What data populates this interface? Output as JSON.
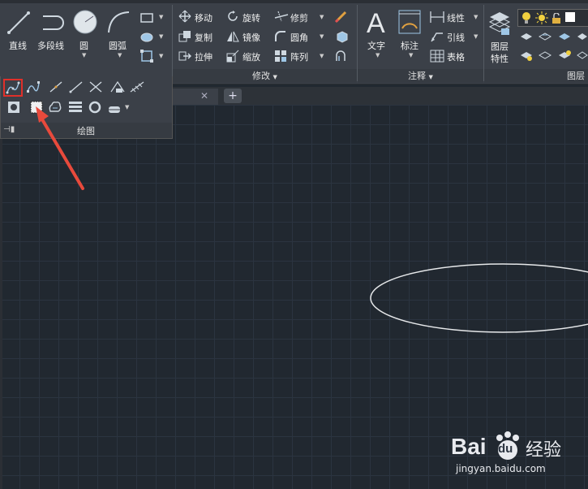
{
  "ribbon": {
    "draw": {
      "line": "直线",
      "polyline": "多段线",
      "circle": "圆",
      "arc": "圆弧"
    },
    "modify": {
      "move": "移动",
      "rotate": "旋转",
      "trim": "修剪",
      "copy": "复制",
      "mirror": "镜像",
      "fillet": "圆角",
      "stretch": "拉伸",
      "scale": "缩放",
      "array": "阵列",
      "panel_title": "修改"
    },
    "annotation": {
      "text": "文字",
      "dimension": "标注",
      "linear": "线性",
      "leader": "引线",
      "table": "表格",
      "panel_title": "注释"
    },
    "layers": {
      "properties_line1": "图层",
      "properties_line2": "特性",
      "panel_title": "图层"
    }
  },
  "flyout": {
    "panel_title": "绘图"
  },
  "watermark": {
    "brand": "Bai",
    "brand_paw": "du",
    "brand_cn": "经验",
    "url": "jingyan.baidu.com"
  },
  "colors": {
    "ribbon_bg": "#3b4048",
    "canvas_bg": "#212830",
    "highlight": "#e0302a",
    "arrow": "#e84a3c"
  }
}
